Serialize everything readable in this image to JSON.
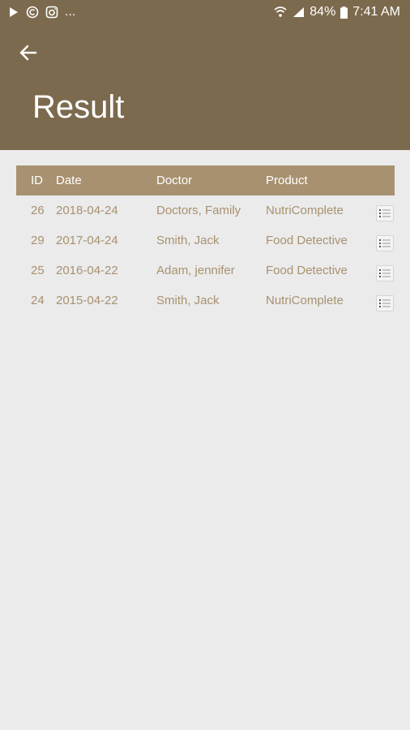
{
  "status": {
    "battery": "84%",
    "time": "7:41 AM",
    "dots": "..."
  },
  "header": {
    "title": "Result"
  },
  "table": {
    "columns": [
      "ID",
      "Date",
      "Doctor",
      "Product"
    ],
    "rows": [
      {
        "id": "26",
        "date": "2018-04-24",
        "doctor": "Doctors, Family",
        "product": "NutriComplete"
      },
      {
        "id": "29",
        "date": "2017-04-24",
        "doctor": "Smith, Jack",
        "product": "Food Detective"
      },
      {
        "id": "25",
        "date": "2016-04-22",
        "doctor": "Adam, jennifer",
        "product": "Food Detective"
      },
      {
        "id": "24",
        "date": "2015-04-22",
        "doctor": "Smith, Jack",
        "product": "NutriComplete"
      }
    ]
  },
  "colors": {
    "appbar": "#7c6a4e",
    "table_header": "#a89170",
    "table_text": "#a89170",
    "background": "#ebebeb"
  },
  "icons": [
    "play-store-icon",
    "copyright-icon",
    "instagram-icon",
    "wifi-icon",
    "signal-icon",
    "battery-icon",
    "back-arrow-icon",
    "list-detail-icon"
  ]
}
